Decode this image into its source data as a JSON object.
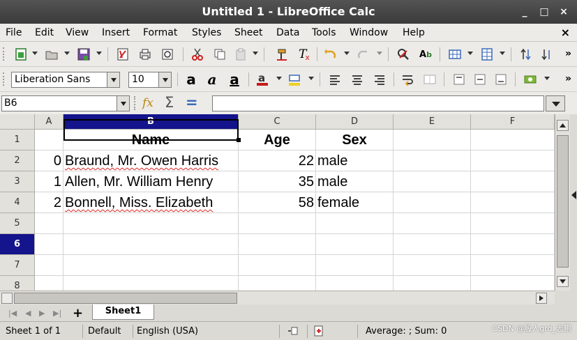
{
  "window": {
    "title": "Untitled 1 - LibreOffice Calc",
    "minimize": "_",
    "maximize": "□",
    "close": "×"
  },
  "menu": {
    "items": [
      "File",
      "Edit",
      "View",
      "Insert",
      "Format",
      "Styles",
      "Sheet",
      "Data",
      "Tools",
      "Window",
      "Help"
    ],
    "close": "×"
  },
  "font_toolbar": {
    "font_name": "Liberation Sans",
    "font_size": "10"
  },
  "formula_bar": {
    "name_box": "B6",
    "function_wizard": "fx",
    "sum": "Σ",
    "equals": "=",
    "content": ""
  },
  "columns": [
    "A",
    "B",
    "C",
    "D",
    "E",
    "F"
  ],
  "rows": [
    "1",
    "2",
    "3",
    "4",
    "5",
    "6",
    "7",
    "8"
  ],
  "selected": {
    "column": "B",
    "row": "6"
  },
  "cells": {
    "header": {
      "B": "Name",
      "C": "Age",
      "D": "Sex"
    },
    "data": [
      {
        "A": "0",
        "B": "Braund, Mr. Owen Harris",
        "C": "22",
        "D": "male"
      },
      {
        "A": "1",
        "B": "Allen, Mr. William Henry",
        "C": "35",
        "D": "male"
      },
      {
        "A": "2",
        "B": "Bonnell, Miss. Elizabeth",
        "C": "58",
        "D": "female"
      }
    ]
  },
  "sheet_tabs": {
    "add": "+",
    "active": "Sheet1"
  },
  "status": {
    "sheet": "Sheet 1 of 1",
    "style": "Default",
    "language": "English (USA)",
    "summary": "Average: ; Sum: 0",
    "watermark": "CSDN @殷人grd_志鹏"
  },
  "colors": {
    "selection_header": "#14148c",
    "spell_underline": "#d22222"
  }
}
